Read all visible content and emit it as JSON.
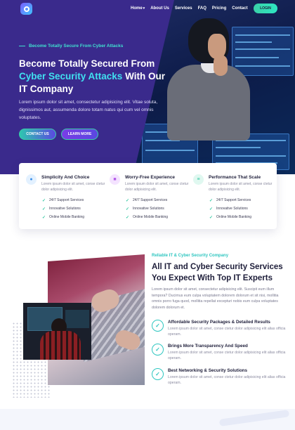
{
  "nav": {
    "items": [
      "Home",
      "About Us",
      "Services",
      "FAQ",
      "Pricing",
      "Contact"
    ],
    "login_label": "LOGIN"
  },
  "hero": {
    "eyebrow": "Become Totally Secure From Cyber Attacks",
    "title_part1": "Become Totally Secured From ",
    "title_highlight": "Cyber Security Attacks",
    "title_part2": " With Our IT Company",
    "description": "Lorem ipsum dolor sit amet, consectetur adipisicing elit. Vitae soluta, dignissimos aut, assumenda dolore totam natus qui cum vel omnis voluptates.",
    "contact_label": "CONTACT US",
    "learn_label": "LEARN MORE"
  },
  "features": [
    {
      "title": "Simplicity And Choice",
      "icon": "shield-icon",
      "icon_color": "#e3f1ff",
      "desc": "Lorem ipsum dolor sit amet, conse ctetur dolor adipisicing elit.",
      "points": [
        "24/7 Support Services",
        "Innovative Solutions",
        "Online Mobile Banking"
      ]
    },
    {
      "title": "Worry-Free Experience",
      "icon": "lock-icon",
      "icon_color": "#f4e3ff",
      "desc": "Lorem ipsum dolor sit amet, conse ctetur dolor adipisicing elit.",
      "points": [
        "24/7 Support Services",
        "Innovative Solutions",
        "Online Mobile Banking"
      ]
    },
    {
      "title": "Performance That Scale",
      "icon": "server-icon",
      "icon_color": "#e0f8f0",
      "desc": "Lorem ipsum dolor sit amet, conse ctetur dolor adipisicing elit.",
      "points": [
        "24/7 Support Services",
        "Innovative Solutions",
        "Online Mobile Banking"
      ]
    }
  ],
  "about": {
    "eyebrow": "Reliable IT & Cyber Security Company",
    "title": "All IT and Cyber Security Services You Expect With Top IT Experts",
    "description": "Lorem ipsum dolor sit amet, consectetur adipisicing elit. Suscipit eum illum tempora? Ducimus eum culpa voluptatem dolorem dolorum et sit nisi, mollitia omnis porro fuga quod, mollitia repellat excepturi nobis eum culpa voluptates dolorem dolorum et.",
    "items": [
      {
        "title": "Affordable Security Packages & Detailed Results",
        "desc": "Lorem ipsum dolor sit amet, conse ctetur dolor adipisicing elit alias officia operam."
      },
      {
        "title": "Brings More Transparency And Speed",
        "desc": "Lorem ipsum dolor sit amet, conse ctetur dolor adipisicing elit alias officia operam."
      },
      {
        "title": "Best Networking & Security Solutions",
        "desc": "Lorem ipsum dolor sit amet, conse ctetur dolor adipisicing elit alias officia operam."
      }
    ]
  },
  "colors": {
    "hero_bg": "#3a2a8c",
    "accent": "#2ec6c0",
    "highlight": "#40e0f0"
  }
}
